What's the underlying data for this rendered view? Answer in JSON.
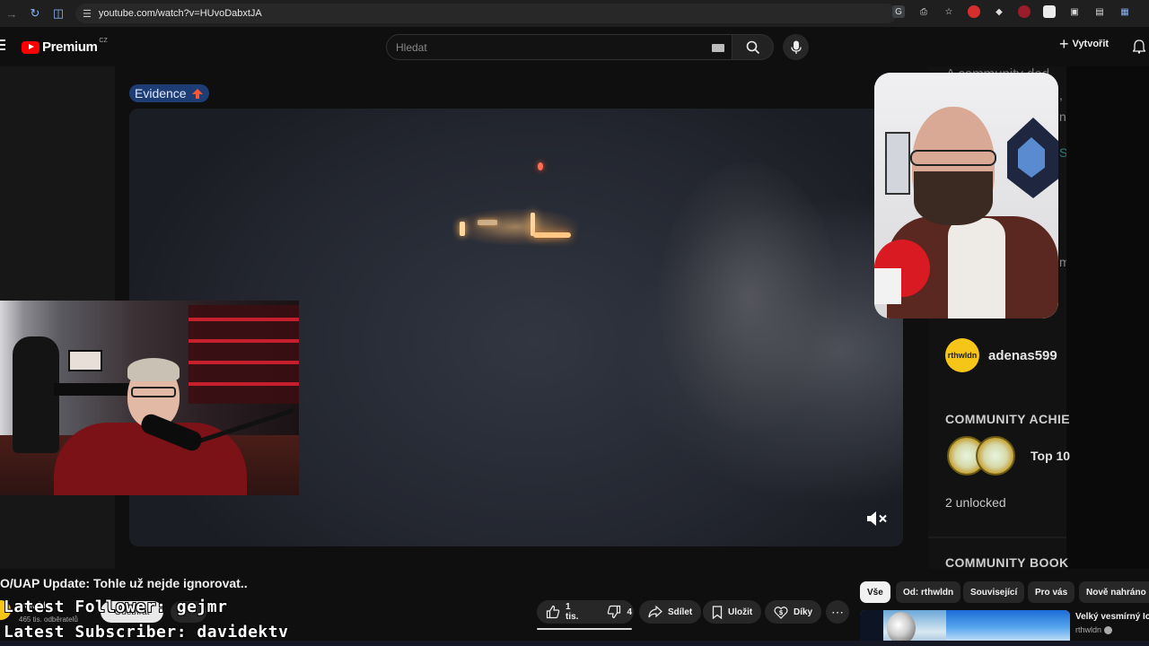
{
  "browser": {
    "url": "youtube.com/watch?v=HUvoDabxtJA"
  },
  "header": {
    "logo_text": "Premium",
    "logo_country": "CZ",
    "search_placeholder": "Hledat",
    "create_label": "Vytvořit"
  },
  "video": {
    "badge_label": "Evidence",
    "title": "O/UAP Update: Tohle už nejde ignorovat..",
    "channel_name": "rthwldn",
    "subscriber_count": "465 tis. odběratelů",
    "join_label": "Odebírat"
  },
  "actions": {
    "likes": "1 tis.",
    "dislikes": "4",
    "share_label": "Sdílet",
    "save_label": "Uložit",
    "thanks_label": "Díky"
  },
  "sidebar": {
    "community_text": "A community ded",
    "edge_chars": [
      ",",
      "n.",
      "S",
      "m"
    ],
    "commenter_avatar_text": "rthwldn",
    "commenter_name": "adenas599",
    "achievements_title": "COMMUNITY ACHIE",
    "achievement_text": "Top 10",
    "unlocked_text": "2 unlocked",
    "books_title": "COMMUNITY BOOK"
  },
  "chips": [
    {
      "label": "Vše",
      "active": true
    },
    {
      "label": "Od: rthwldn",
      "active": false
    },
    {
      "label": "Související",
      "active": false
    },
    {
      "label": "Pro vás",
      "active": false
    },
    {
      "label": "Nově nahráno",
      "active": false
    }
  ],
  "recommendation": {
    "title": "Velký vesmírný Ice",
    "channel": "rthwldn"
  },
  "stream_overlay": {
    "latest_follower": "Latest Follower: gejmr",
    "latest_subscriber": "Latest Subscriber: davidektv"
  },
  "colors": {
    "background": "#0f0f0f",
    "youtube_red": "#ff0000",
    "evidence_badge": "#1e3d75",
    "commenter_avatar": "#f5c518"
  }
}
